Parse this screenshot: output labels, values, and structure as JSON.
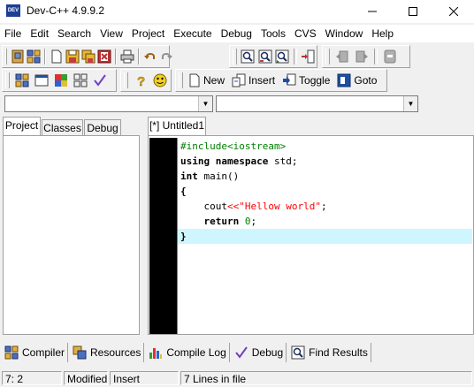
{
  "window": {
    "title": "Dev-C++ 4.9.9.2",
    "icon_text": "DEV"
  },
  "menu": [
    "File",
    "Edit",
    "Search",
    "View",
    "Project",
    "Execute",
    "Debug",
    "Tools",
    "CVS",
    "Window",
    "Help"
  ],
  "toolbar": {
    "new_label": "New",
    "insert_label": "Insert",
    "toggle_label": "Toggle",
    "goto_label": "Goto"
  },
  "left_tabs": [
    "Project",
    "Classes",
    "Debug"
  ],
  "editor": {
    "tab_label": "[*] Untitled1",
    "lines": {
      "l1_directive": "#include",
      "l1_header": "<iostream>",
      "l2_kw1": "using",
      "l2_kw2": "namespace",
      "l2_rest": " std;",
      "l3_kw": "int",
      "l3_rest": " main()",
      "l4": "{",
      "l5_indent": "    cout",
      "l5_op": "<<",
      "l5_str": "\"Hellow world\"",
      "l5_end": ";",
      "l6_indent": "    ",
      "l6_kw": "return",
      "l6_space": " ",
      "l6_num": "0",
      "l6_end": ";",
      "l7": "}"
    }
  },
  "bottom_tabs": [
    "Compiler",
    "Resources",
    "Compile Log",
    "Debug",
    "Find Results"
  ],
  "status": {
    "position": "7: 2",
    "modified": "Modified",
    "mode": "Insert",
    "lines": "7 Lines in file"
  },
  "colors": {
    "current_line": "#cff6ff",
    "keyword": "#000000",
    "preprocessor": "#008000",
    "string": "#ff0000",
    "gutter": "#000000"
  }
}
